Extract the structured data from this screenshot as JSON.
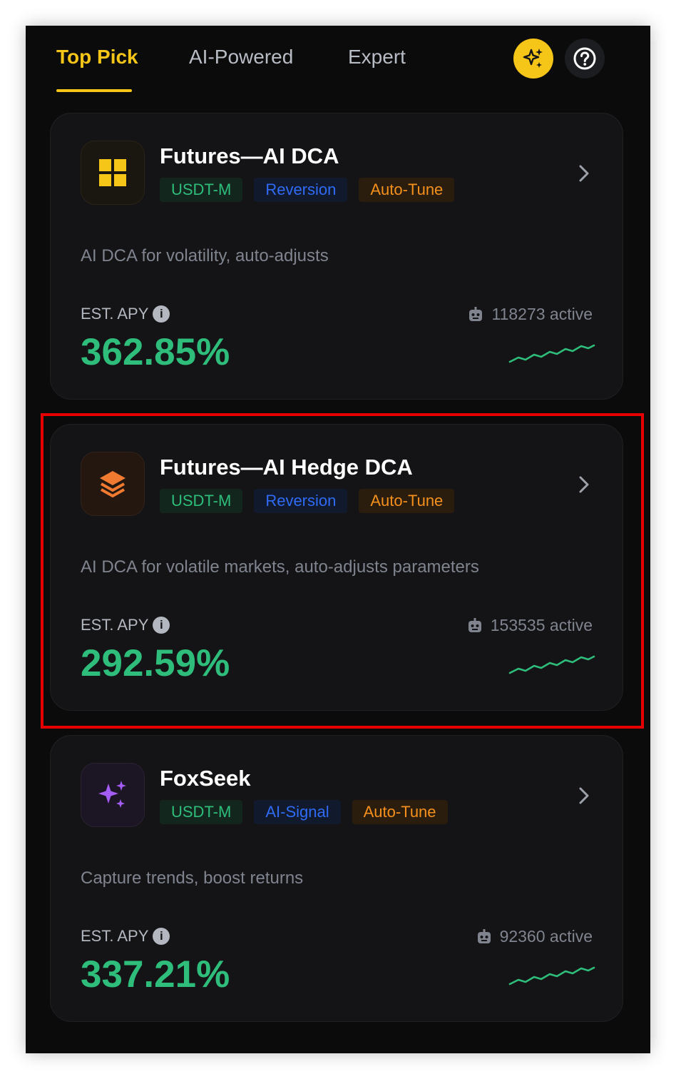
{
  "tabs": [
    {
      "label": "Top Pick",
      "active": true
    },
    {
      "label": "AI-Powered",
      "active": false
    },
    {
      "label": "Expert",
      "active": false
    }
  ],
  "header_icons": {
    "ai": "sparkle-icon",
    "help": "help-circle-icon"
  },
  "colors": {
    "accent": "#f5c518",
    "positive": "#2ebd7a",
    "tag_blue": "#2f6bf5",
    "tag_orange": "#f5901c",
    "highlight": "#e60000"
  },
  "cards": [
    {
      "title": "Futures—AI DCA",
      "icon": "grid-icon",
      "tags": [
        "USDT-M",
        "Reversion",
        "Auto-Tune"
      ],
      "description": "AI DCA for volatility, auto-adjusts",
      "apy_label": "EST. APY",
      "apy_value": "362.85%",
      "active": "118273 active",
      "highlighted": false
    },
    {
      "title": "Futures—AI Hedge DCA",
      "icon": "layers-icon",
      "tags": [
        "USDT-M",
        "Reversion",
        "Auto-Tune"
      ],
      "description": "AI DCA for volatile markets, auto-adjusts parameters",
      "apy_label": "EST. APY",
      "apy_value": "292.59%",
      "active": "153535 active",
      "highlighted": true
    },
    {
      "title": "FoxSeek",
      "icon": "sparkle-icon",
      "tags": [
        "USDT-M",
        "AI-Signal",
        "Auto-Tune"
      ],
      "description": "Capture trends, boost returns",
      "apy_label": "EST. APY",
      "apy_value": "337.21%",
      "active": "92360 active",
      "highlighted": false
    }
  ]
}
